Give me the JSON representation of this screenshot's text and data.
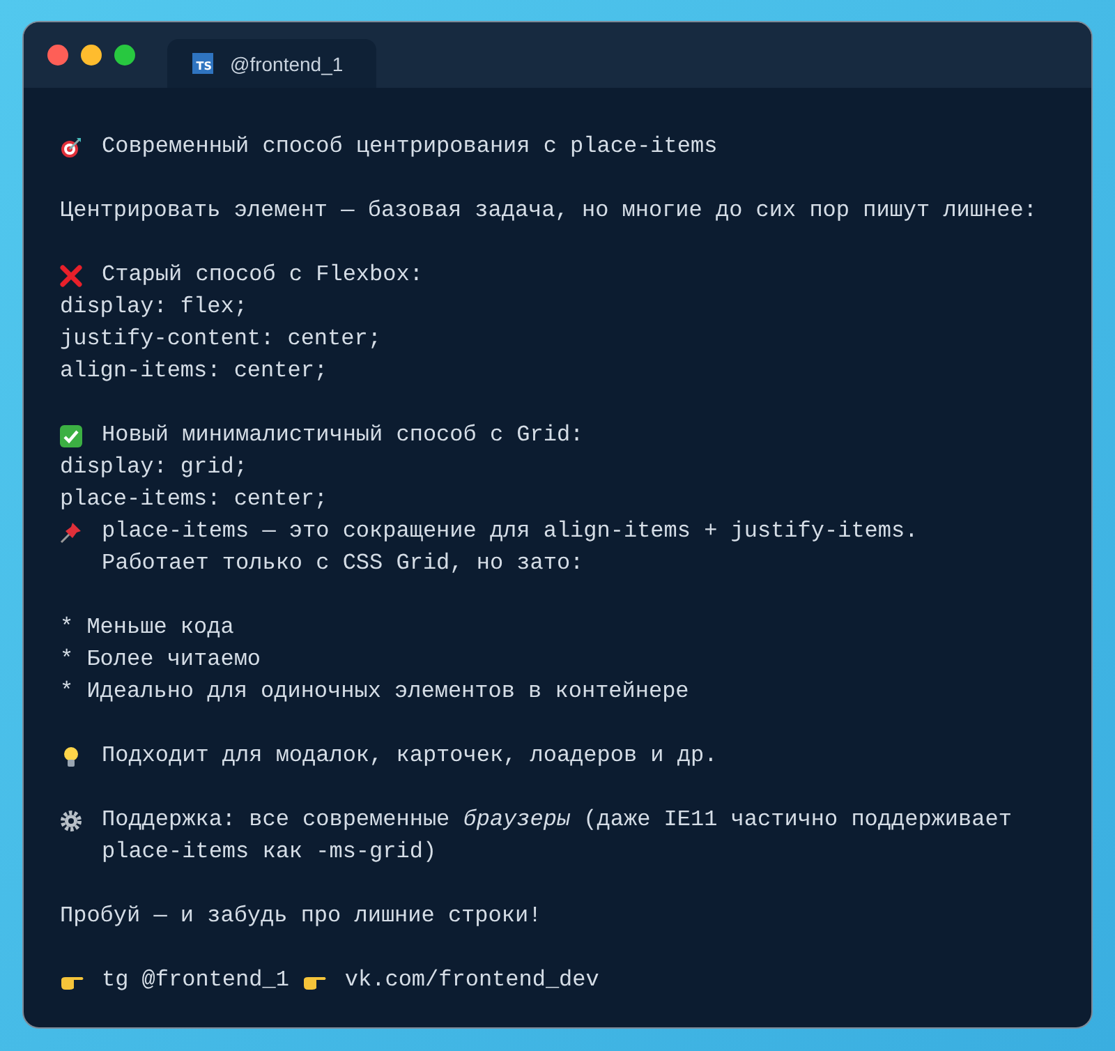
{
  "window": {
    "tab": {
      "file_icon": "TS",
      "label": "@frontend_1"
    }
  },
  "blocks": [
    {
      "rows": [
        {
          "segments": [
            {
              "kind": "target",
              "lines": [
                "Современный способ центрирования с place-items"
              ]
            }
          ]
        }
      ]
    },
    {
      "rows": [
        {
          "segments": [
            {
              "lines": [
                "Центрировать элемент — базовая задача, но многие до сих пор пишут лишнее:"
              ]
            }
          ]
        }
      ]
    },
    {
      "rows": [
        {
          "segments": [
            {
              "kind": "cross",
              "lines": [
                "Старый способ с Flexbox:"
              ]
            }
          ]
        },
        {
          "segments": [
            {
              "lines": [
                "display: flex;"
              ]
            }
          ]
        },
        {
          "segments": [
            {
              "lines": [
                "justify-content: center;"
              ]
            }
          ]
        },
        {
          "segments": [
            {
              "lines": [
                "align-items: center;"
              ]
            }
          ]
        }
      ]
    },
    {
      "rows": [
        {
          "segments": [
            {
              "kind": "check",
              "lines": [
                "Новый минималистичный способ с Grid:"
              ]
            }
          ]
        },
        {
          "segments": [
            {
              "lines": [
                "display: grid;"
              ]
            }
          ]
        },
        {
          "segments": [
            {
              "lines": [
                "place-items: center;"
              ]
            }
          ]
        },
        {
          "segments": [
            {
              "kind": "pin",
              "lines": [
                "place-items — это сокращение для align-items + justify-items.",
                "Работает только с CSS Grid, но зато:"
              ]
            }
          ]
        }
      ]
    },
    {
      "rows": [
        {
          "segments": [
            {
              "lines": [
                "* Меньше кода"
              ]
            }
          ]
        },
        {
          "segments": [
            {
              "lines": [
                "* Более читаемо"
              ]
            }
          ]
        },
        {
          "segments": [
            {
              "lines": [
                "* Идеально для одиночных элементов в контейнере"
              ]
            }
          ]
        }
      ]
    },
    {
      "rows": [
        {
          "segments": [
            {
              "kind": "bulb",
              "lines": [
                "Подходит для модалок, карточек, лоадеров и др."
              ]
            }
          ]
        }
      ]
    },
    {
      "rows": [
        {
          "segments": [
            {
              "kind": "gear",
              "lines": [
                "Поддержка: все современные *браузеры* (даже IE11 частично поддерживает",
                "place-items как -ms-grid)"
              ]
            }
          ]
        }
      ]
    },
    {
      "rows": [
        {
          "segments": [
            {
              "lines": [
                "Пробуй — и забудь про лишние строки!"
              ]
            }
          ]
        }
      ]
    },
    {
      "rows": [
        {
          "segments": [
            {
              "kind": "hand",
              "lines": [
                "tg @frontend_1"
              ]
            },
            {
              "kind": "hand",
              "lines": [
                "vk.com/frontend_dev"
              ]
            }
          ]
        }
      ]
    }
  ]
}
